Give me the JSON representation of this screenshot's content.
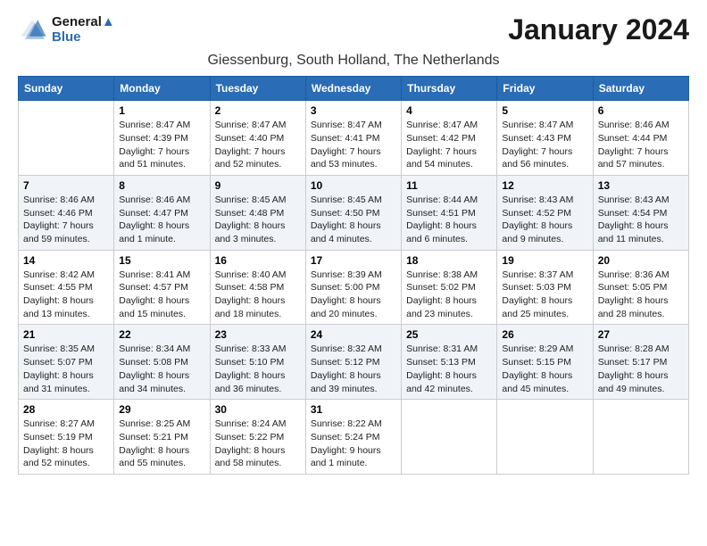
{
  "header": {
    "logo_line1": "General",
    "logo_line2": "Blue",
    "month_title": "January 2024",
    "location": "Giessenburg, South Holland, The Netherlands"
  },
  "weekdays": [
    "Sunday",
    "Monday",
    "Tuesday",
    "Wednesday",
    "Thursday",
    "Friday",
    "Saturday"
  ],
  "weeks": [
    [
      {
        "day": "",
        "info": ""
      },
      {
        "day": "1",
        "info": "Sunrise: 8:47 AM\nSunset: 4:39 PM\nDaylight: 7 hours\nand 51 minutes."
      },
      {
        "day": "2",
        "info": "Sunrise: 8:47 AM\nSunset: 4:40 PM\nDaylight: 7 hours\nand 52 minutes."
      },
      {
        "day": "3",
        "info": "Sunrise: 8:47 AM\nSunset: 4:41 PM\nDaylight: 7 hours\nand 53 minutes."
      },
      {
        "day": "4",
        "info": "Sunrise: 8:47 AM\nSunset: 4:42 PM\nDaylight: 7 hours\nand 54 minutes."
      },
      {
        "day": "5",
        "info": "Sunrise: 8:47 AM\nSunset: 4:43 PM\nDaylight: 7 hours\nand 56 minutes."
      },
      {
        "day": "6",
        "info": "Sunrise: 8:46 AM\nSunset: 4:44 PM\nDaylight: 7 hours\nand 57 minutes."
      }
    ],
    [
      {
        "day": "7",
        "info": "Sunrise: 8:46 AM\nSunset: 4:46 PM\nDaylight: 7 hours\nand 59 minutes."
      },
      {
        "day": "8",
        "info": "Sunrise: 8:46 AM\nSunset: 4:47 PM\nDaylight: 8 hours\nand 1 minute."
      },
      {
        "day": "9",
        "info": "Sunrise: 8:45 AM\nSunset: 4:48 PM\nDaylight: 8 hours\nand 3 minutes."
      },
      {
        "day": "10",
        "info": "Sunrise: 8:45 AM\nSunset: 4:50 PM\nDaylight: 8 hours\nand 4 minutes."
      },
      {
        "day": "11",
        "info": "Sunrise: 8:44 AM\nSunset: 4:51 PM\nDaylight: 8 hours\nand 6 minutes."
      },
      {
        "day": "12",
        "info": "Sunrise: 8:43 AM\nSunset: 4:52 PM\nDaylight: 8 hours\nand 9 minutes."
      },
      {
        "day": "13",
        "info": "Sunrise: 8:43 AM\nSunset: 4:54 PM\nDaylight: 8 hours\nand 11 minutes."
      }
    ],
    [
      {
        "day": "14",
        "info": "Sunrise: 8:42 AM\nSunset: 4:55 PM\nDaylight: 8 hours\nand 13 minutes."
      },
      {
        "day": "15",
        "info": "Sunrise: 8:41 AM\nSunset: 4:57 PM\nDaylight: 8 hours\nand 15 minutes."
      },
      {
        "day": "16",
        "info": "Sunrise: 8:40 AM\nSunset: 4:58 PM\nDaylight: 8 hours\nand 18 minutes."
      },
      {
        "day": "17",
        "info": "Sunrise: 8:39 AM\nSunset: 5:00 PM\nDaylight: 8 hours\nand 20 minutes."
      },
      {
        "day": "18",
        "info": "Sunrise: 8:38 AM\nSunset: 5:02 PM\nDaylight: 8 hours\nand 23 minutes."
      },
      {
        "day": "19",
        "info": "Sunrise: 8:37 AM\nSunset: 5:03 PM\nDaylight: 8 hours\nand 25 minutes."
      },
      {
        "day": "20",
        "info": "Sunrise: 8:36 AM\nSunset: 5:05 PM\nDaylight: 8 hours\nand 28 minutes."
      }
    ],
    [
      {
        "day": "21",
        "info": "Sunrise: 8:35 AM\nSunset: 5:07 PM\nDaylight: 8 hours\nand 31 minutes."
      },
      {
        "day": "22",
        "info": "Sunrise: 8:34 AM\nSunset: 5:08 PM\nDaylight: 8 hours\nand 34 minutes."
      },
      {
        "day": "23",
        "info": "Sunrise: 8:33 AM\nSunset: 5:10 PM\nDaylight: 8 hours\nand 36 minutes."
      },
      {
        "day": "24",
        "info": "Sunrise: 8:32 AM\nSunset: 5:12 PM\nDaylight: 8 hours\nand 39 minutes."
      },
      {
        "day": "25",
        "info": "Sunrise: 8:31 AM\nSunset: 5:13 PM\nDaylight: 8 hours\nand 42 minutes."
      },
      {
        "day": "26",
        "info": "Sunrise: 8:29 AM\nSunset: 5:15 PM\nDaylight: 8 hours\nand 45 minutes."
      },
      {
        "day": "27",
        "info": "Sunrise: 8:28 AM\nSunset: 5:17 PM\nDaylight: 8 hours\nand 49 minutes."
      }
    ],
    [
      {
        "day": "28",
        "info": "Sunrise: 8:27 AM\nSunset: 5:19 PM\nDaylight: 8 hours\nand 52 minutes."
      },
      {
        "day": "29",
        "info": "Sunrise: 8:25 AM\nSunset: 5:21 PM\nDaylight: 8 hours\nand 55 minutes."
      },
      {
        "day": "30",
        "info": "Sunrise: 8:24 AM\nSunset: 5:22 PM\nDaylight: 8 hours\nand 58 minutes."
      },
      {
        "day": "31",
        "info": "Sunrise: 8:22 AM\nSunset: 5:24 PM\nDaylight: 9 hours\nand 1 minute."
      },
      {
        "day": "",
        "info": ""
      },
      {
        "day": "",
        "info": ""
      },
      {
        "day": "",
        "info": ""
      }
    ]
  ]
}
